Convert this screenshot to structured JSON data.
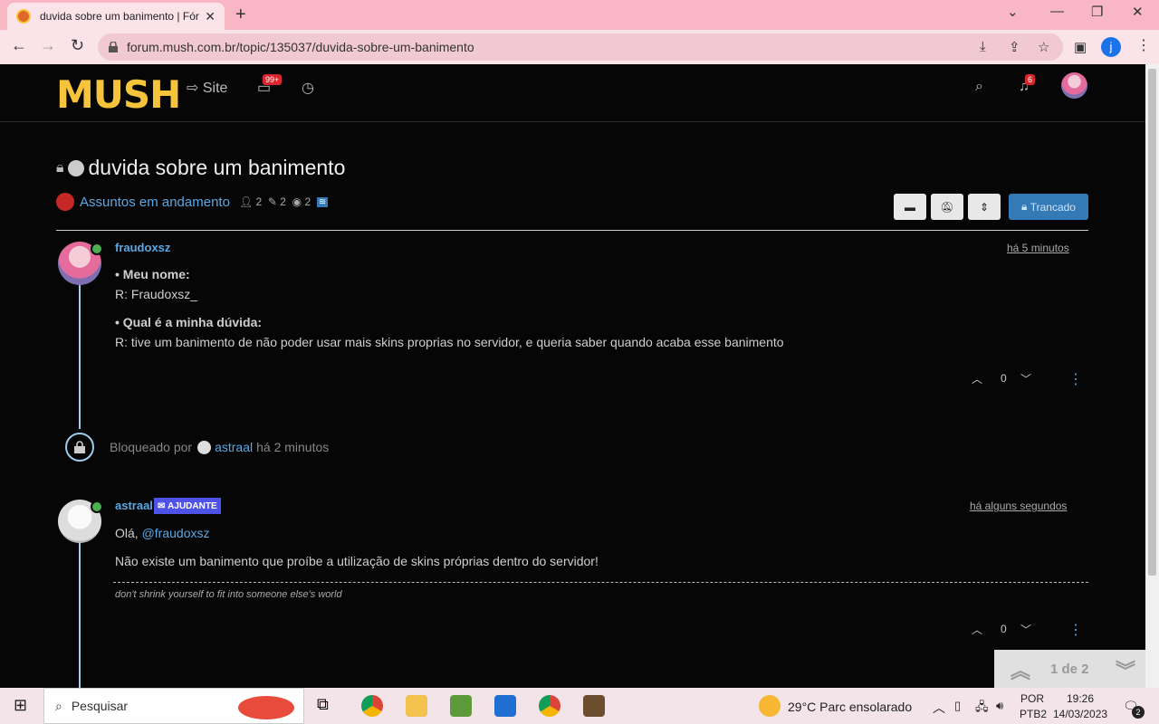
{
  "browser": {
    "tab_title": "duvida sobre um banimento | Fór",
    "url": "forum.mush.com.br/topic/135037/duvida-sobre-um-banimento",
    "profile_initial": "j"
  },
  "site": {
    "logo": "MUSH",
    "nav_site": "Site",
    "inbox_badge": "99+",
    "notif_badge": "6"
  },
  "topic": {
    "title": "duvida sobre um banimento",
    "category": "Assuntos em andamento",
    "posters": "2",
    "posts": "2",
    "views": "2",
    "locked_label": "Trancado"
  },
  "posts": [
    {
      "author": "fraudoxsz",
      "time": "há 5 minutos",
      "q1": "• Meu nome:",
      "a1": "R: Fraudoxsz_",
      "q2": "• Qual é a minha dúvida:",
      "a2": "R: tive um banimento de não poder usar mais skins proprias no servidor, e queria saber quando acaba esse banimento",
      "votes": "0"
    },
    {
      "author": "astraal",
      "group": "AJUDANTE",
      "time": "há alguns segundos",
      "greet": "Olá,",
      "mention": "@fraudoxsz",
      "body": "Não existe um banimento que proíbe a utilização de skins próprias dentro do servidor!",
      "signature": "don't shrink yourself to fit into someone else's world",
      "votes": "0"
    }
  ],
  "event": {
    "prefix": "Bloqueado por",
    "user": "astraal",
    "time": "há 2 minutos"
  },
  "pager": "1 de 2",
  "taskbar": {
    "search_placeholder": "Pesquisar",
    "weather": "29°C  Parc ensolarado",
    "lang1": "POR",
    "lang2": "PTB2",
    "time": "19:26",
    "date": "14/03/2023",
    "notif": "2"
  }
}
